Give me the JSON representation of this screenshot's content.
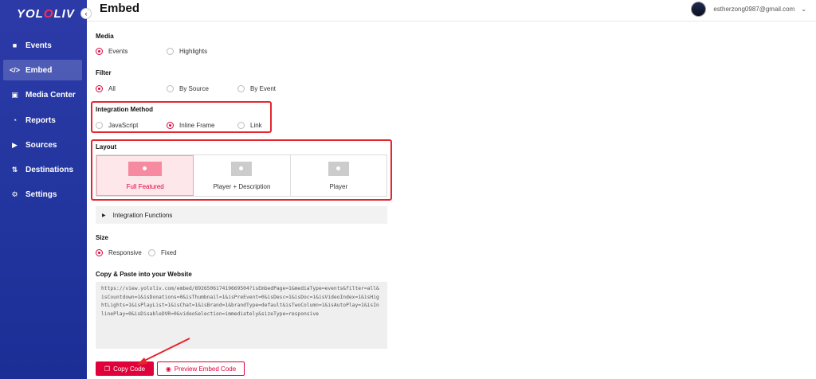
{
  "brand": {
    "logo_text_a": "YOL",
    "logo_text_o": "O",
    "logo_text_b": "LIV",
    "accent": "#e0003a"
  },
  "sidebar": {
    "items": [
      {
        "label": "Events",
        "icon": "video-camera-icon"
      },
      {
        "label": "Embed",
        "icon": "code-icon",
        "active": true
      },
      {
        "label": "Media Center",
        "icon": "media-icon"
      },
      {
        "label": "Reports",
        "icon": "pie-chart-icon"
      },
      {
        "label": "Sources",
        "icon": "camera-icon"
      },
      {
        "label": "Destinations",
        "icon": "share-icon"
      },
      {
        "label": "Settings",
        "icon": "gear-icon"
      }
    ]
  },
  "header": {
    "title": "Embed",
    "user_email": "estherzong0987@gmail.com"
  },
  "media": {
    "label": "Media",
    "options": [
      "Events",
      "Highlights"
    ],
    "selected": "Events"
  },
  "filter": {
    "label": "Filter",
    "options": [
      "All",
      "By Source",
      "By Event"
    ],
    "selected": "All"
  },
  "integration": {
    "label": "Integration Method",
    "options": [
      "JavaScript",
      "Inline Frame",
      "Link"
    ],
    "selected": "Inline Frame"
  },
  "layout": {
    "label": "Layout",
    "options": [
      "Full Featured",
      "Player + Description",
      "Player"
    ],
    "selected": "Full Featured"
  },
  "functions": {
    "label": "Integration Functions"
  },
  "size": {
    "label": "Size",
    "options": [
      "Responsive",
      "Fixed"
    ],
    "selected": "Responsive"
  },
  "code": {
    "label": "Copy & Paste into your Website",
    "value": "https://view.yololiv.com/embed/892650617419669504?isEmbedPage=1&mediaType=events&filter=all&isCountdown=1&isDonations=0&isThumbnail=1&isPreEvent=0&isDesc=1&isDoc=1&isVideoIndex=1&isHightLights=1&isPlayList=1&isChat=1&isBrand=1&brandType=default&isTwoColumn=1&isAutoPlay=1&isInlinePlay=0&isDisableDVR=0&videoSelection=immediately&sizeType=responsive"
  },
  "actions": {
    "copy_label": "Copy Code",
    "preview_label": "Preview Embed Code"
  }
}
